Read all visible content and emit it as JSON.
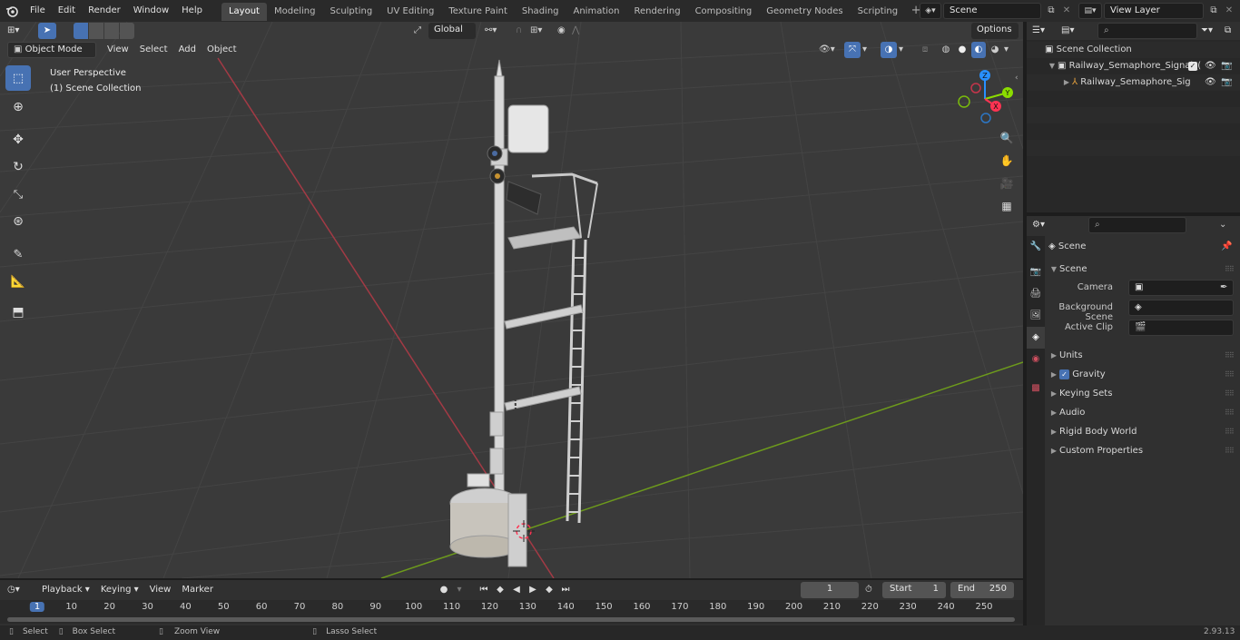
{
  "app": {
    "menu": [
      "File",
      "Edit",
      "Render",
      "Window",
      "Help"
    ],
    "workspaces": [
      "Layout",
      "Modeling",
      "Sculpting",
      "UV Editing",
      "Texture Paint",
      "Shading",
      "Animation",
      "Rendering",
      "Compositing",
      "Geometry Nodes",
      "Scripting"
    ],
    "active_workspace": "Layout",
    "scene_name": "Scene",
    "view_layer": "View Layer",
    "version": "2.93.13"
  },
  "viewport": {
    "mode": "Object Mode",
    "header_menus": [
      "View",
      "Select",
      "Add",
      "Object"
    ],
    "transform_orientation": "Global",
    "options_label": "Options",
    "overlay_text_1": "User Perspective",
    "overlay_text_2": "(1) Scene Collection",
    "gizmo_axes": {
      "x": "X",
      "y": "Y",
      "z": "Z"
    }
  },
  "outliner": {
    "root": "Scene Collection",
    "items": [
      {
        "label": "Railway_Semaphore_Signal_("
      },
      {
        "label": "Railway_Semaphore_Sig"
      }
    ]
  },
  "properties": {
    "header": "Scene",
    "section": "Scene",
    "fields": [
      {
        "label": "Camera"
      },
      {
        "label": "Background Scene"
      },
      {
        "label": "Active Clip"
      }
    ],
    "panels": [
      "Units",
      "Gravity",
      "Keying Sets",
      "Audio",
      "Rigid Body World",
      "Custom Properties"
    ],
    "gravity_checked": true
  },
  "timeline": {
    "menus": [
      "Playback",
      "Keying",
      "View",
      "Marker"
    ],
    "current_frame": "1",
    "start_label": "Start",
    "start": "1",
    "end_label": "End",
    "end": "250",
    "ruler": [
      "1",
      "10",
      "20",
      "30",
      "40",
      "50",
      "60",
      "70",
      "80",
      "90",
      "100",
      "110",
      "120",
      "130",
      "140",
      "150",
      "160",
      "170",
      "180",
      "190",
      "200",
      "210",
      "220",
      "230",
      "240",
      "250"
    ]
  },
  "statusbar": {
    "items": [
      "Select",
      "Box Select",
      "Zoom View",
      "Lasso Select"
    ]
  },
  "colors": {
    "accent": "#4772b3",
    "x_axis": "#ff3352",
    "y_axis": "#8bdc00",
    "z_axis": "#2890ff",
    "viewport_bg": "#3a3a3a"
  }
}
